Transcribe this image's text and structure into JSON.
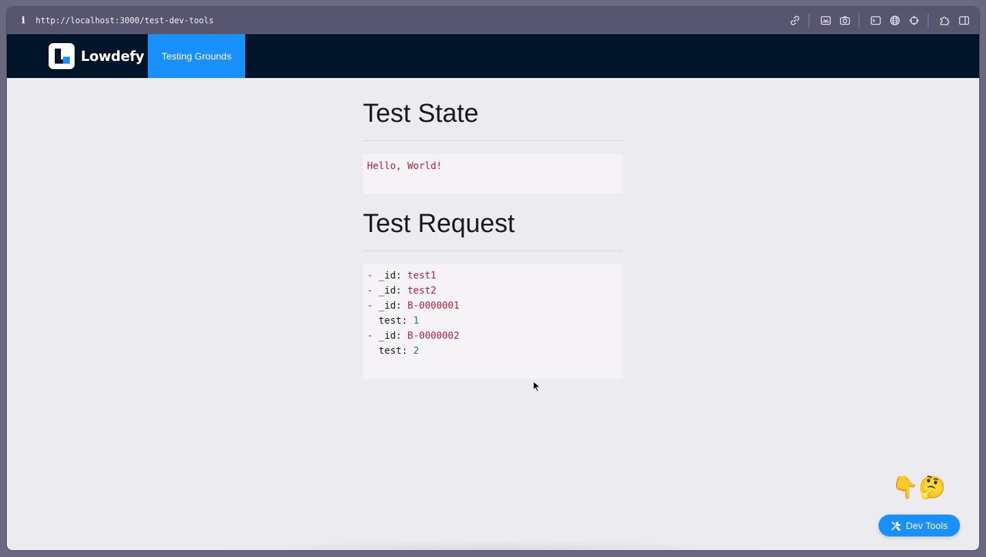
{
  "browser": {
    "info_icon": "i",
    "url": "http://localhost:3000/test-dev-tools",
    "toolbar_icons": [
      "link-icon",
      "download-icon",
      "camera-icon",
      "terminal-icon",
      "globe-icon",
      "crosshair-icon",
      "extension-icon",
      "sidebar-icon"
    ]
  },
  "navbar": {
    "brand": "Lowdefy",
    "items": [
      {
        "label": "Testing Grounds",
        "active": true
      }
    ],
    "colors": {
      "background": "#001529",
      "accent": "#1890ff"
    }
  },
  "main": {
    "state_title": "Test State",
    "state_value": "Hello, World!",
    "request_title": "Test Request",
    "request_lines": [
      {
        "dash": "-",
        "key": "_id:",
        "value": "test1",
        "type": "string"
      },
      {
        "dash": "-",
        "key": "_id:",
        "value": "test2",
        "type": "string"
      },
      {
        "dash": "-",
        "key": "_id:",
        "value": "B-0000001",
        "type": "string"
      },
      {
        "dash": "",
        "key": "test:",
        "value": "1",
        "type": "number"
      },
      {
        "dash": "-",
        "key": "_id:",
        "value": "B-0000002",
        "type": "string"
      },
      {
        "dash": "",
        "key": "test:",
        "value": "2",
        "type": "number"
      }
    ]
  },
  "floating": {
    "emoji": "👇🤔",
    "devtools_label": "Dev Tools"
  }
}
